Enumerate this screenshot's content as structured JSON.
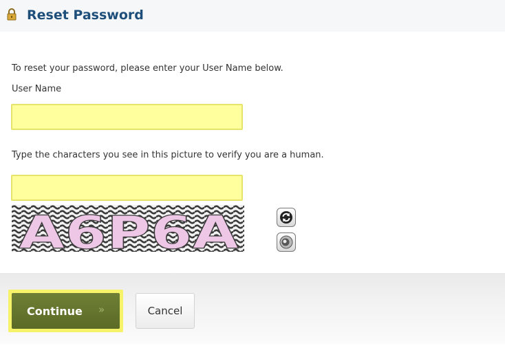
{
  "header": {
    "title": "Reset Password",
    "icon": "lock-icon"
  },
  "form": {
    "instructions": "To reset your password, please enter your User Name below.",
    "username_label": "User Name",
    "username_value": "",
    "captcha_prompt": "Type the characters you see in this picture to verify you are a human.",
    "captcha_value": "",
    "captcha_text": "A6P6A",
    "captcha_refresh_icon": "refresh-icon",
    "captcha_audio_icon": "speaker-icon"
  },
  "footer": {
    "continue_label": "Continue",
    "continue_arrow": "»",
    "cancel_label": "Cancel"
  },
  "colors": {
    "title": "#1e4f7a",
    "input_fill": "#ffff9e",
    "continue_button": "#5b6b26",
    "focus_highlight": "#f6f36a"
  }
}
